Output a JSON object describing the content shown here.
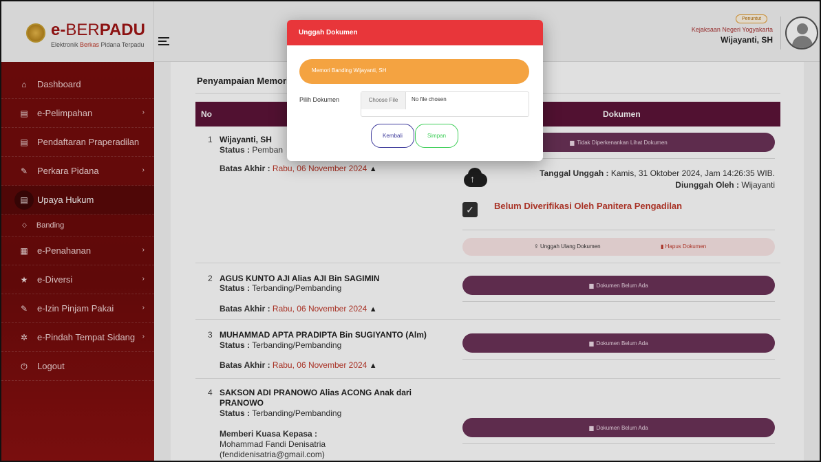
{
  "brand": {
    "title_bold": "e-",
    "title_light": "BER",
    "title_bold2": "PADU",
    "subtitle_a": "Elektronik ",
    "subtitle_b": "Berkas",
    "subtitle_c": " Pidana Terpadu"
  },
  "sidebar": {
    "items": [
      {
        "label": "Dashboard",
        "icon": "home-icon",
        "glyph": "⌂"
      },
      {
        "label": "e-Pelimpahan",
        "icon": "docs-icon",
        "glyph": "▤",
        "chevron": "›"
      },
      {
        "label": "Pendaftaran Praperadilan",
        "icon": "docs-icon",
        "glyph": "▤"
      },
      {
        "label": "Perkara Pidana",
        "icon": "edit-icon",
        "glyph": "✎",
        "chevron": "›"
      },
      {
        "label": "Upaya Hukum",
        "icon": "docs-icon",
        "glyph": "▤"
      },
      {
        "label": "e-Penahanan",
        "icon": "grid-icon",
        "glyph": "▦",
        "chevron": "›"
      },
      {
        "label": "e-Diversi",
        "icon": "star-icon",
        "glyph": "★",
        "chevron": "›"
      },
      {
        "label": "e-Izin Pinjam Pakai",
        "icon": "edit-icon",
        "glyph": "✎",
        "chevron": "›"
      },
      {
        "label": "e-Pindah Tempat Sidang",
        "icon": "gear-icon",
        "glyph": "✲",
        "chevron": "›"
      },
      {
        "label": "Logout",
        "icon": "power-icon",
        "glyph": "⏻"
      }
    ],
    "sub_item": "Banding"
  },
  "header": {
    "badge": "Penuntut",
    "org": "Kejaksaan Negeri Yogyakarta",
    "user": "Wijayanti, SH"
  },
  "main": {
    "section_title": "Penyampaian Memori",
    "col_no": "No",
    "col_dokumen": "Dokumen",
    "status_label": "Status :",
    "batas_label": "Batas Akhir :",
    "rows": [
      {
        "no": "1",
        "name": "Wijayanti, SH",
        "status": "Pemban",
        "batas": "Rabu, 06 November 2024"
      },
      {
        "no": "2",
        "name": "AGUS KUNTO AJI Alias AJI Bin SAGIMIN",
        "status": "Terbanding/Pembanding",
        "batas": "Rabu, 06 November 2024"
      },
      {
        "no": "3",
        "name": "MUHAMMAD APTA PRADIPTA Bin SUGIYANTO (Alm)",
        "status": "Terbanding/Pembanding",
        "batas": "Rabu, 06 November 2024"
      },
      {
        "no": "4",
        "name": "SAKSON ADI PRANOWO Alias ACONG Anak dari",
        "name2": "PRANOWO",
        "status": "Terbanding/Pembanding",
        "kuasa_label": "Memberi Kuasa Kepasa :",
        "kuasa_name": "Mohammad Fandi Denisatria",
        "kuasa_email": "(fendidenisatria@gmail.com)"
      }
    ],
    "doc_not_allowed": "Tidak Diperkenankan Lihat Dokumen",
    "doc_not_exist": "Dokumen Belum Ada",
    "tanggal_label": "Tanggal Unggah :",
    "tanggal_value": "Kamis, 31 Oktober 2024, Jam 14:26:35 WIB.",
    "diunggah_label": "Diunggah Oleh :",
    "diunggah_value": "Wijayanti",
    "verif_text": "Belum Diverifikasi Oleh Panitera Pengadilan",
    "reupload": "Unggah Ulang Dokumen",
    "delete": "Hapus Dokumen"
  },
  "modal": {
    "title": "Unggah Dokumen",
    "doc_name": "Memori Banding Wijayanti, SH",
    "pilih_label": "Pilih Dokumen",
    "choose_file": "Choose File",
    "no_file": "No file chosen",
    "btn_back": "Kembali",
    "btn_save": "Simpan"
  },
  "colors": {
    "sidebar": "#7a0d0d",
    "table_head": "#5d1438",
    "modal_head": "#e8363a",
    "doc_pill": "#f4a341",
    "save_green": "#3fcf59",
    "back_blue": "#3f3c9c"
  }
}
